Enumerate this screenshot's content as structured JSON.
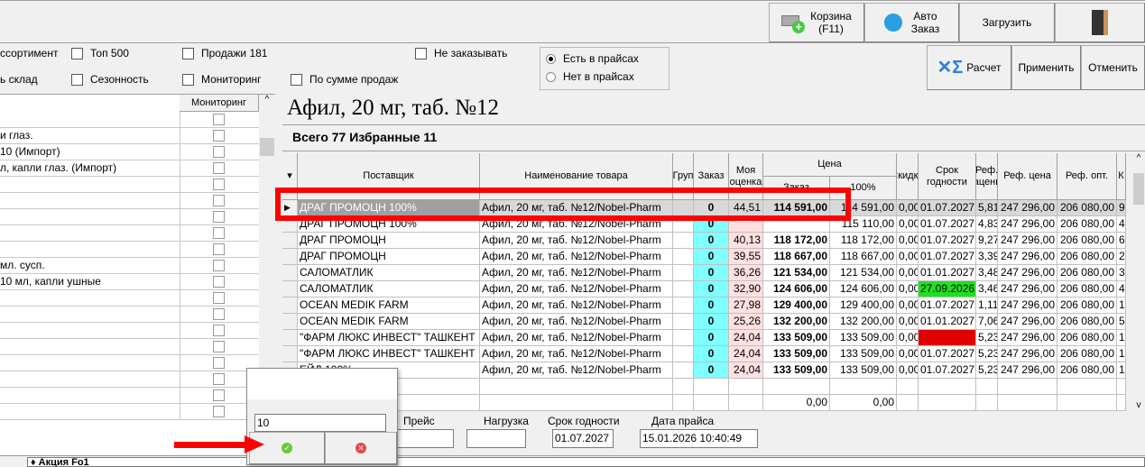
{
  "toolbar": {
    "cart_label": "Корзина",
    "cart_key": "(F11)",
    "auto_label1": "Авто",
    "auto_label2": "Заказ",
    "load_label": "Загрузить"
  },
  "filters": {
    "row1": [
      "ссортимент",
      "Топ 500",
      "Продажи 181",
      "Не заказывать"
    ],
    "row2": [
      "ь склад",
      "Сезонность",
      "Мониторинг",
      "По сумме продаж"
    ],
    "radio": [
      {
        "label": "Есть в прайсах",
        "selected": true
      },
      {
        "label": "Нет в прайсах",
        "selected": false
      }
    ]
  },
  "actions": {
    "calc": "Расчет",
    "apply": "Применить",
    "cancel": "Отменить"
  },
  "left_panel": {
    "monitor_header": "Мониторинг",
    "rows": [
      "",
      "и глаз.",
      "10 (Импорт)",
      "л, капли глаз. (Импорт)",
      "",
      "",
      "",
      "",
      "",
      "мл. сусп.",
      "10 мл, капли ушные",
      "",
      "",
      "",
      "",
      "",
      "",
      "",
      ""
    ]
  },
  "product": {
    "title": "Афил, 20 мг, таб. №12",
    "summary": "Всего 77 Избранные 11"
  },
  "grid": {
    "headers": {
      "supplier": "Поставщик",
      "name": "Наименование товара",
      "group": "Груп",
      "order": "Заказ",
      "my": "Моя оценка",
      "price": "Цена",
      "price_order": "Заказ",
      "price_100": "100%",
      "discount": "Скидка",
      "expiry": "Срок годности",
      "ref_markup": "Реф. наценка",
      "ref_price": "Реф. цена",
      "ref_opt": "Реф. опт.",
      "extra": "К"
    },
    "rows": [
      [
        "ДРАГ ПРОМОЦН 100%",
        "Афил, 20 мг, таб. №12/Nobel-Pharm",
        "",
        "0",
        "44,51",
        "114 591,00",
        "114 591,00",
        "0,00",
        "01.07.2027",
        "5,81",
        "247 296,00",
        "206 080,00",
        "9"
      ],
      [
        "ДРАГ ПРОМОЦН 100%",
        "Афил, 20 мг, таб. №12/Nobel-Pharm",
        "",
        "0",
        "",
        "",
        "115 110,00",
        "0,00",
        "01.07.2027",
        "4,83",
        "247 296,00",
        "206 080,00",
        "4"
      ],
      [
        "ДРАГ ПРОМОЦН",
        "Афил, 20 мг, таб. №12/Nobel-Pharm",
        "",
        "0",
        "40,13",
        "118 172,00",
        "118 172,00",
        "0,00",
        "01.07.2027",
        "9,27",
        "247 296,00",
        "206 080,00",
        "6"
      ],
      [
        "ДРАГ ПРОМОЦН",
        "Афил, 20 мг, таб. №12/Nobel-Pharm",
        "",
        "0",
        "39,55",
        "118 667,00",
        "118 667,00",
        "0,00",
        "01.07.2027",
        "3,39",
        "247 296,00",
        "206 080,00",
        "2"
      ],
      [
        "САЛОМАТЛИК",
        "Афил, 20 мг, таб. №12/Nobel-Pharm",
        "",
        "0",
        "36,26",
        "121 534,00",
        "121 534,00",
        "0,00",
        "01.01.2027",
        "3,48",
        "247 296,00",
        "206 080,00",
        "3"
      ],
      [
        "САЛОМАТЛИК",
        "Афил, 20 мг, таб. №12/Nobel-Pharm",
        "",
        "0",
        "32,90",
        "124 606,00",
        "124 606,00",
        "0,00",
        "27.09.2026",
        "3,46",
        "247 296,00",
        "206 080,00",
        "4"
      ],
      [
        "OCEAN MEDIK FARM",
        "Афил, 20 мг, таб. №12/Nobel-Pharm",
        "",
        "0",
        "27,98",
        "129 400,00",
        "129 400,00",
        "0,00",
        "01.07.2027",
        "1,11",
        "247 296,00",
        "206 080,00",
        "1"
      ],
      [
        "OCEAN MEDIK FARM",
        "Афил, 20 мг, таб. №12/Nobel-Pharm",
        "",
        "0",
        "25,26",
        "132 200,00",
        "132 200,00",
        "0,00",
        "01.01.2027",
        "7,06",
        "247 296,00",
        "206 080,00",
        "5"
      ],
      [
        "\"ФАРМ ЛЮКС ИНВЕСТ\" ТАШКЕНТ",
        "Афил, 20 мг, таб. №12/Nobel-Pharm",
        "",
        "0",
        "24,04",
        "133 509,00",
        "133 509,00",
        "0,00",
        "",
        "5,23",
        "247 296,00",
        "206 080,00",
        "1"
      ],
      [
        "\"ФАРМ ЛЮКС ИНВЕСТ\" ТАШКЕНТ",
        "Афил, 20 мг, таб. №12/Nobel-Pharm",
        "",
        "0",
        "24,04",
        "133 509,00",
        "133 509,00",
        "0,00",
        "01.07.2027",
        "5,23",
        "247 296,00",
        "206 080,00",
        "1"
      ],
      [
        "ЕЙД 100%",
        "Афил, 20 мг, таб. №12/Nobel-Pharm",
        "",
        "0",
        "24,04",
        "133 509,00",
        "133 509,00",
        "0,00",
        "01.07.2027",
        "5,23",
        "247 296,00",
        "206 080,00",
        "1"
      ]
    ],
    "totals": {
      "price_order": "0,00",
      "price_100": "0,00"
    },
    "colors": {
      "order_col": "#80ffff",
      "my_col": "#ffe0e0",
      "expiry_green": "#20e020",
      "expiry_red": "#e00000",
      "selected": "#a0a0a0"
    }
  },
  "bottom": {
    "price_label": "Прейс",
    "load_label": "Нагрузка",
    "expiry_label": "Срок годности",
    "expiry_value": "01.07.2027",
    "date_label": "Дата прайса",
    "date_value": "15.01.2026 10:40:49",
    "promo": "♦ Акция Fo1"
  },
  "popup": {
    "value": "10"
  },
  "annotation_color": "#ff0000"
}
